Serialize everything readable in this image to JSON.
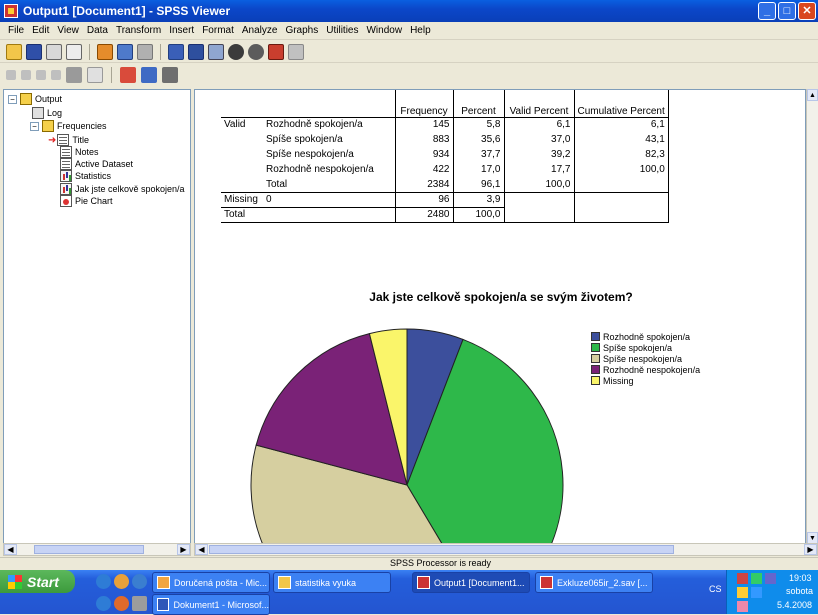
{
  "window": {
    "title": "Output1 [Document1] - SPSS Viewer",
    "minimize_glyph": "_",
    "maximize_glyph": "□",
    "close_glyph": "✕"
  },
  "menu": [
    "File",
    "Edit",
    "View",
    "Data",
    "Transform",
    "Insert",
    "Format",
    "Analyze",
    "Graphs",
    "Utilities",
    "Window",
    "Help"
  ],
  "toolbar_icons": [
    "open-icon",
    "save-icon",
    "print-icon",
    "print-preview-icon",
    "export-icon",
    "dialog-recall-icon",
    "undo-icon",
    "goto-case-icon",
    "variables-icon",
    "use-sets-icon",
    "show-all-icon",
    "designate-window-icon",
    "insert-icon"
  ],
  "toolbar2_icons": [
    "promote-icon",
    "demote-icon",
    "expand-icon",
    "collapse-icon",
    "show-icon",
    "hide-icon",
    "insert-heading-icon",
    "insert-title-icon",
    "insert-text-icon"
  ],
  "outline": {
    "root": "Output",
    "log": "Log",
    "frequencies": "Frequencies",
    "items": [
      "Title",
      "Notes",
      "Active Dataset",
      "Statistics",
      "Jak jste celkově spokojen/a",
      "Pie Chart"
    ],
    "expander_minus": "−"
  },
  "frequency_table": {
    "headers": [
      "Frequency",
      "Percent",
      "Valid Percent",
      "Cumulative Percent"
    ],
    "valid_label": "Valid",
    "missing_label": "Missing",
    "total_label": "Total",
    "rows": [
      {
        "label": "Rozhodně spokojen/a",
        "freq": "145",
        "pct": "5,8",
        "valid": "6,1",
        "cum": "6,1"
      },
      {
        "label": "Spíše spokojen/a",
        "freq": "883",
        "pct": "35,6",
        "valid": "37,0",
        "cum": "43,1"
      },
      {
        "label": "Spíše nespokojen/a",
        "freq": "934",
        "pct": "37,7",
        "valid": "39,2",
        "cum": "82,3"
      },
      {
        "label": "Rozhodně nespokojen/a",
        "freq": "422",
        "pct": "17,0",
        "valid": "17,7",
        "cum": "100,0"
      },
      {
        "label": "Total",
        "freq": "2384",
        "pct": "96,1",
        "valid": "100,0",
        "cum": ""
      }
    ],
    "missing_row": {
      "label": "0",
      "freq": "96",
      "pct": "3,9"
    },
    "total_row": {
      "freq": "2480",
      "pct": "100,0"
    }
  },
  "chart_data": {
    "type": "pie",
    "title": "Jak jste celkově spokojen/a se svým životem?",
    "categories": [
      "Rozhodně spokojen/a",
      "Spíše spokojen/a",
      "Spíše nespokojen/a",
      "Rozhodně nespokojen/a",
      "Missing"
    ],
    "values": [
      145,
      883,
      934,
      422,
      96
    ],
    "colors": [
      "#3C4F9C",
      "#2EB84A",
      "#D6CFA0",
      "#7A2277",
      "#FAF56A"
    ],
    "legend": "right"
  },
  "status": {
    "text": "SPSS Processor is ready"
  },
  "taskbar": {
    "start": "Start",
    "tasks": [
      "Doručená pošta - Mic...",
      "statistika vyuka",
      "Output1 [Document1...",
      "Exkluze065ir_2.sav [...",
      "Dokument1 - Microsof..."
    ],
    "tray": {
      "lang": "CS",
      "time": "19:03",
      "day": "sobota",
      "date": "5.4.2008"
    }
  }
}
